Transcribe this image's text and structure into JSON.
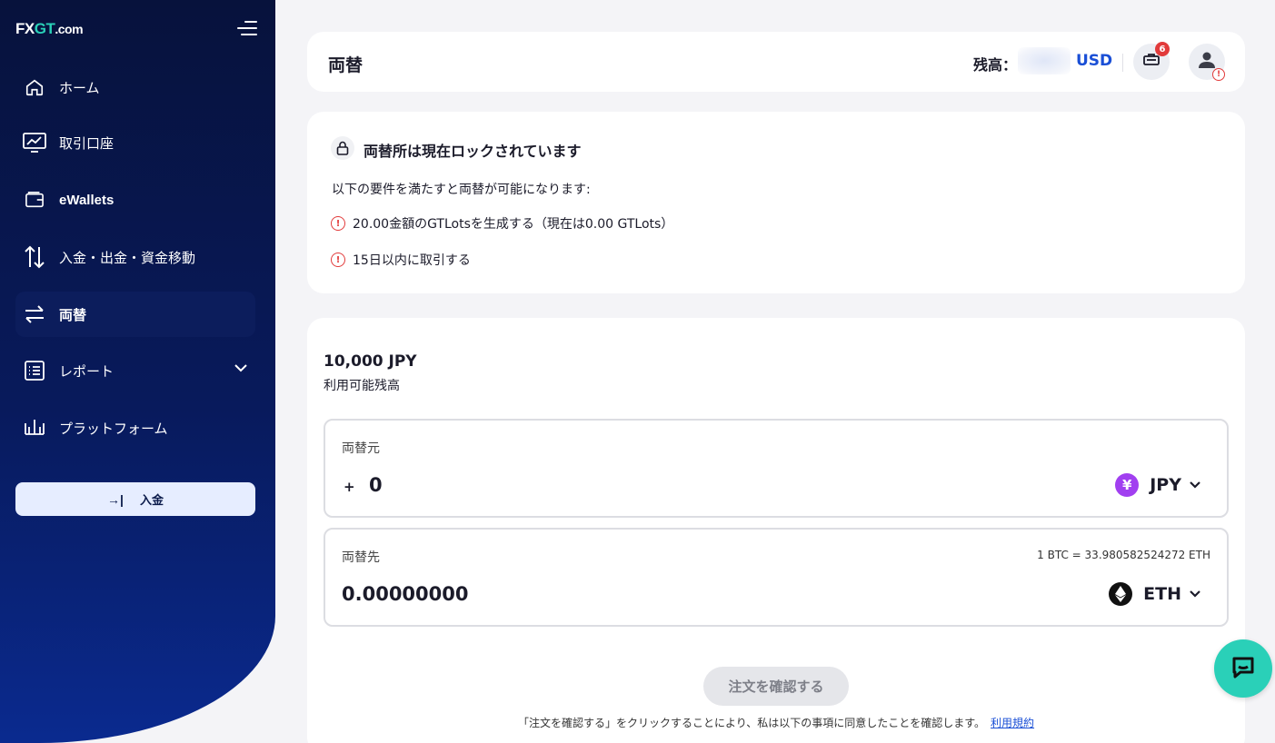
{
  "brand": {
    "fx": "FX",
    "gt": "GT",
    "com": ".com"
  },
  "sidebar": {
    "items": [
      {
        "label": "ホーム",
        "icon": "home-icon"
      },
      {
        "label": "取引口座",
        "icon": "chart-monitor-icon"
      },
      {
        "label": "eWallets",
        "icon": "wallet-icon"
      },
      {
        "label": "入金・出金・資金移動",
        "icon": "transfer-arrows-icon"
      },
      {
        "label": "両替",
        "icon": "exchange-icon",
        "active": true
      },
      {
        "label": "レポート",
        "icon": "report-list-icon",
        "has_children": true
      },
      {
        "label": "プラットフォーム",
        "icon": "platform-icon"
      }
    ],
    "deposit_button": "入金"
  },
  "header": {
    "title": "両替",
    "balance_label": "残高：",
    "balance_currency": "USD",
    "notification_count": "6"
  },
  "lock_notice": {
    "title": "両替所は現在ロックされています",
    "description": "以下の要件を満たすと両替が可能になります:",
    "requirements": [
      "20.00金額のGTLotsを生成する（現在は0.00 GTLots）",
      "15日以内に取引する"
    ]
  },
  "exchange": {
    "available_amount": "10,000 JPY",
    "available_label": "利用可能残高",
    "from": {
      "label": "両替元",
      "sign": "+",
      "amount": "0",
      "currency": "JPY"
    },
    "to": {
      "label": "両替先",
      "amount": "0.00000000",
      "currency": "ETH",
      "rate": "1 BTC = 33.980582524272 ETH"
    },
    "confirm_button": "注文を確認する",
    "terms_text": "「注文を確認する」をクリックすることにより、私は以下の事項に同意したことを確認します。",
    "terms_link": "利用規約"
  },
  "colors": {
    "sidebar_bg": "#07123c",
    "accent_teal": "#2ad0b8",
    "link_blue": "#1a4fd6",
    "warning_red": "#e23b3b",
    "jpy_coin": "#a13ff0",
    "eth_coin": "#111111"
  }
}
